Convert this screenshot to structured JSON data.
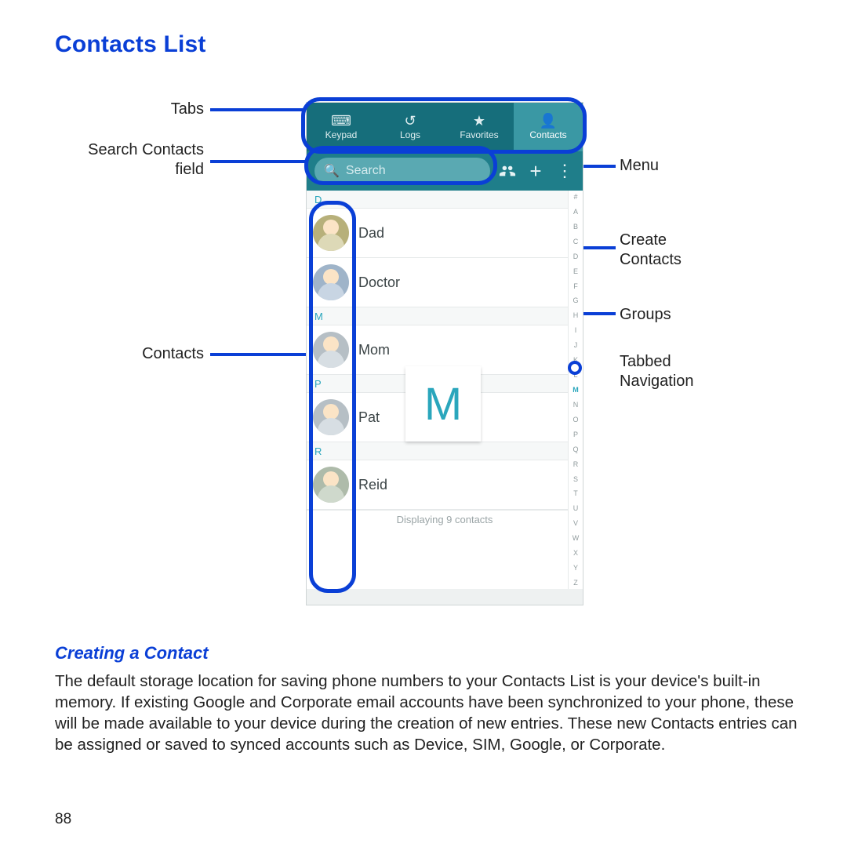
{
  "page": {
    "title": "Contacts List",
    "subtitle": "Creating a Contact",
    "body": "The default storage location for saving phone numbers to your Contacts List is your device's built-in memory. If existing Google and Corporate email accounts have been synchronized to your phone, these will be made available to your device during the creation of new entries. These new Contacts entries can be assigned or saved to synced accounts such as Device, SIM, Google, or Corporate.",
    "number": "88"
  },
  "callouts": {
    "left": {
      "tabs": "Tabs",
      "search_l1": "Search Contacts",
      "search_l2": "field",
      "contacts": "Contacts"
    },
    "right": {
      "menu": "Menu",
      "create_l1": "Create",
      "create_l2": "Contacts",
      "groups": "Groups",
      "nav_l1": "Tabbed",
      "nav_l2": "Navigation"
    }
  },
  "phone": {
    "tabs": [
      {
        "icon": "⌨",
        "label": "Keypad"
      },
      {
        "icon": "↺",
        "label": "Logs"
      },
      {
        "icon": "★",
        "label": "Favorites"
      },
      {
        "icon": "👤",
        "label": "Contacts"
      }
    ],
    "active_tab_index": 3,
    "search_placeholder": "Search",
    "toolbar_icons": {
      "groups": "groups-icon",
      "add": "plus-icon",
      "menu": "kebab-icon"
    },
    "sections": [
      {
        "letter": "D",
        "contacts": [
          "Dad",
          "Doctor"
        ]
      },
      {
        "letter": "M",
        "contacts": [
          "Mom"
        ]
      },
      {
        "letter": "P",
        "contacts": [
          "Pat"
        ]
      },
      {
        "letter": "R",
        "contacts": [
          "Reid"
        ]
      }
    ],
    "status": "Displaying 9 contacts",
    "index_letters": [
      "#",
      "A",
      "B",
      "C",
      "D",
      "E",
      "F",
      "G",
      "H",
      "I",
      "J",
      "K",
      "L",
      "M",
      "N",
      "O",
      "P",
      "Q",
      "R",
      "S",
      "T",
      "U",
      "V",
      "W",
      "X",
      "Y",
      "Z"
    ],
    "current_letter": "M",
    "preview_letter": "M"
  },
  "colors": {
    "accent": "#0a3fd6",
    "app_teal_dark": "#166e7b",
    "app_teal": "#1f7e8a",
    "app_teal_light": "#3a98a4",
    "letter_accent": "#2aa6bc"
  }
}
